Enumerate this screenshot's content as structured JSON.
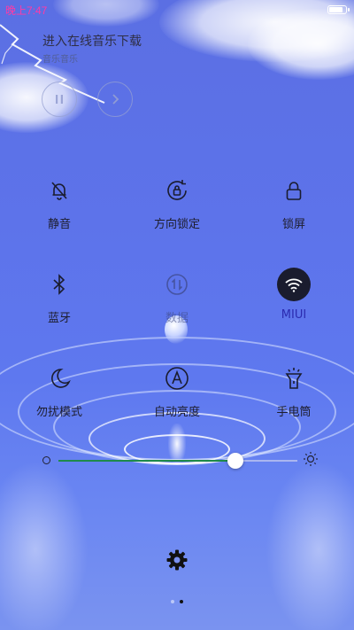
{
  "status_bar": {
    "time": "晚上7:47",
    "battery_level": 0.9
  },
  "music": {
    "title": "进入在线音乐下载",
    "subtitle": "音乐音乐",
    "pause_icon": "pause-icon",
    "next_icon": "next-icon"
  },
  "toggles": [
    {
      "key": "mute",
      "label": "静音",
      "icon": "bell-off-icon",
      "state": "off"
    },
    {
      "key": "rotation_lock",
      "label": "方向锁定",
      "icon": "rotation-lock-icon",
      "state": "off"
    },
    {
      "key": "lock_screen",
      "label": "锁屏",
      "icon": "lock-icon",
      "state": "off"
    },
    {
      "key": "bluetooth",
      "label": "蓝牙",
      "icon": "bluetooth-icon",
      "state": "off"
    },
    {
      "key": "data",
      "label": "数据",
      "icon": "data-icon",
      "state": "disabled"
    },
    {
      "key": "wifi",
      "label": "MIUI",
      "icon": "wifi-icon",
      "state": "on"
    },
    {
      "key": "dnd",
      "label": "勿扰模式",
      "icon": "moon-icon",
      "state": "off"
    },
    {
      "key": "auto_brightness",
      "label": "自动亮度",
      "icon": "auto-brightness-icon",
      "state": "off"
    },
    {
      "key": "flashlight",
      "label": "手电筒",
      "icon": "flashlight-icon",
      "state": "off"
    }
  ],
  "brightness": {
    "level": 0.74
  },
  "pager": {
    "pages": 2,
    "current": 2
  },
  "colors": {
    "accent": "#2b2bb0",
    "active_bg": "#1a1c2e",
    "slider_fill": "#1f8a4a",
    "clock": "#ff3aa6"
  }
}
